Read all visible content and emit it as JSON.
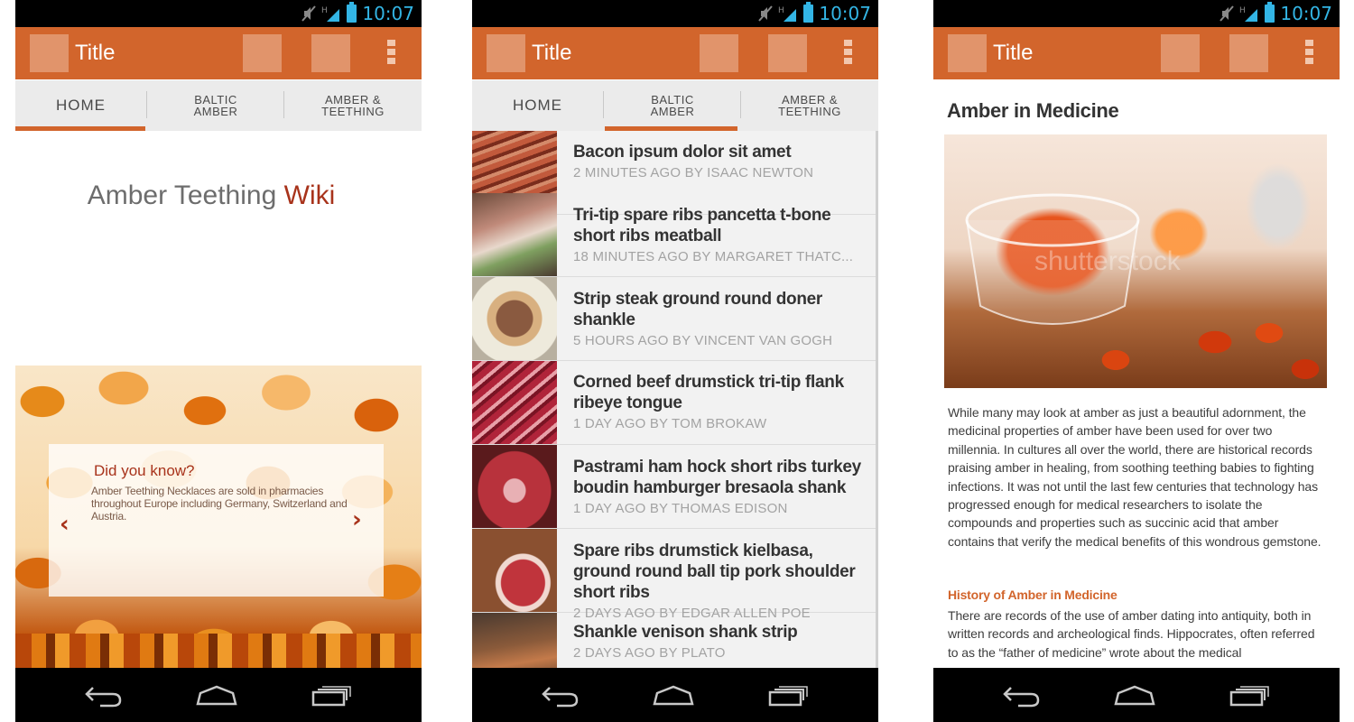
{
  "status_bar": {
    "time": "10:07"
  },
  "action_bar": {
    "title": "Title"
  },
  "tabs": [
    {
      "label": "HOME"
    },
    {
      "label_line1": "BALTIC",
      "label_line2": "AMBER"
    },
    {
      "label_line1": "AMBER &",
      "label_line2": "TEETHING"
    }
  ],
  "home": {
    "title_main": "Amber Teething",
    "title_accent": "Wiki",
    "did_you_know": {
      "heading": "Did you know?",
      "body": "Amber Teething Necklaces are sold in pharmacies throughout Europe including Germany, Switzerland and Austria.",
      "prev_glyph": "‹",
      "next_glyph": "›"
    }
  },
  "baltic_amber": {
    "items": [
      {
        "title": "Bacon ipsum dolor sit amet",
        "meta": "2 MINUTES AGO BY ISAAC NEWTON"
      },
      {
        "title": "Tri-tip spare ribs pancetta t-bone short ribs meatball",
        "meta": "18 MINUTES AGO BY MARGARET THATC..."
      },
      {
        "title": "Strip steak ground round doner shankle",
        "meta": "5 HOURS AGO BY VINCENT VAN GOGH"
      },
      {
        "title": "Corned beef drumstick tri-tip flank ribeye tongue",
        "meta": "1 DAY AGO BY TOM BROKAW"
      },
      {
        "title": "Pastrami ham hock short ribs turkey boudin hamburger bresaola shank",
        "meta": "1 DAY AGO BY THOMAS EDISON"
      },
      {
        "title": "Spare ribs drumstick kielbasa, ground round ball tip pork shoulder short ribs",
        "meta": "2 DAYS AGO BY EDGAR ALLEN POE"
      },
      {
        "title": "Shankle venison shank strip",
        "meta": "2 DAYS AGO BY PLATO"
      }
    ]
  },
  "article": {
    "title": "Amber in Medicine",
    "body": "While many may look at amber as just a beautiful adornment, the medicinal properties of amber have been used for over two millennia.  In cultures all over the world, there are historical records praising amber in healing, from soothing teething babies to fighting infections. It was not until the last few centuries that technology has progressed enough for medical researchers to isolate the compounds and properties such as succinic acid that amber contains that verify the medical benefits of this wondrous gemstone.",
    "subheading": "History of Amber in Medicine",
    "body2": "There are records of the use of amber dating into antiquity, both in written records and archeological finds. Hippocrates, often referred to as the “father of medicine” wrote about the medical",
    "image_watermark": "shutterstock"
  },
  "colors": {
    "accent": "#d2652c",
    "accent_dark": "#a8331b",
    "status_blue": "#33b5e5"
  },
  "icons": [
    "mute-icon",
    "signal-icon",
    "battery-icon",
    "overflow-menu-icon",
    "back-icon",
    "home-icon",
    "recent-apps-icon"
  ]
}
